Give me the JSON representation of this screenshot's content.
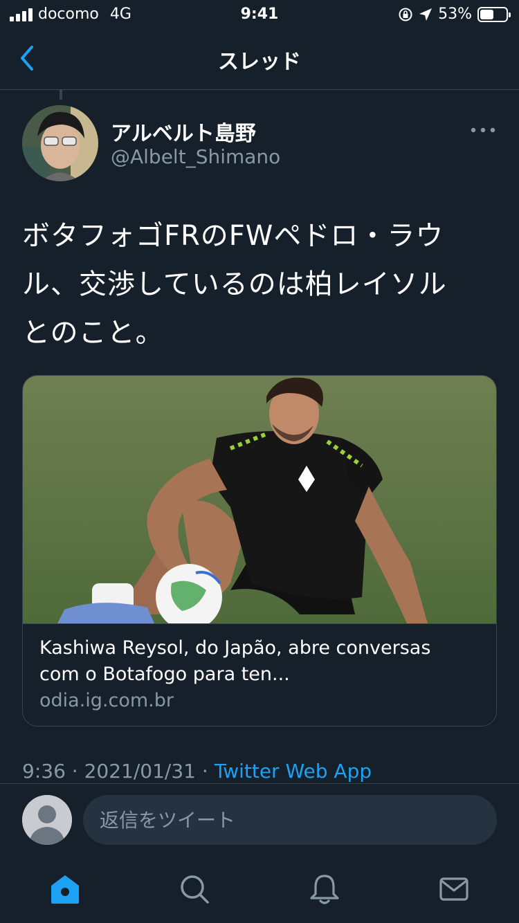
{
  "status_bar": {
    "carrier": "docomo",
    "network": "4G",
    "time": "9:41",
    "battery": "53%",
    "battery_level": 0.53
  },
  "header": {
    "title": "スレッド",
    "back_icon": "chevron-left-icon"
  },
  "tweet": {
    "author_name": "アルベルト島野",
    "author_handle": "@Albelt_Shimano",
    "text_lines": [
      "ボタフォゴFRのFWペドロ・ラウ",
      "ル、交渉しているのは柏レイソル",
      "とのこと。"
    ],
    "card": {
      "title_lines": [
        "Kashiwa Reysol, do Japão, abre conversas",
        "com o Botafogo para ten..."
      ],
      "domain": "odia.ig.com.br"
    },
    "time": "9:36",
    "date": "2021/01/31",
    "separator": "·",
    "source": "Twitter Web App"
  },
  "reply": {
    "placeholder": "返信をツイート"
  },
  "tabs": [
    {
      "icon": "home-icon",
      "active": true
    },
    {
      "icon": "search-icon",
      "active": false
    },
    {
      "icon": "bell-icon",
      "active": false
    },
    {
      "icon": "mail-icon",
      "active": false
    }
  ],
  "colors": {
    "background": "#15202b",
    "accent": "#1da1f2",
    "secondary_text": "#8899a6",
    "border": "#38444d"
  }
}
